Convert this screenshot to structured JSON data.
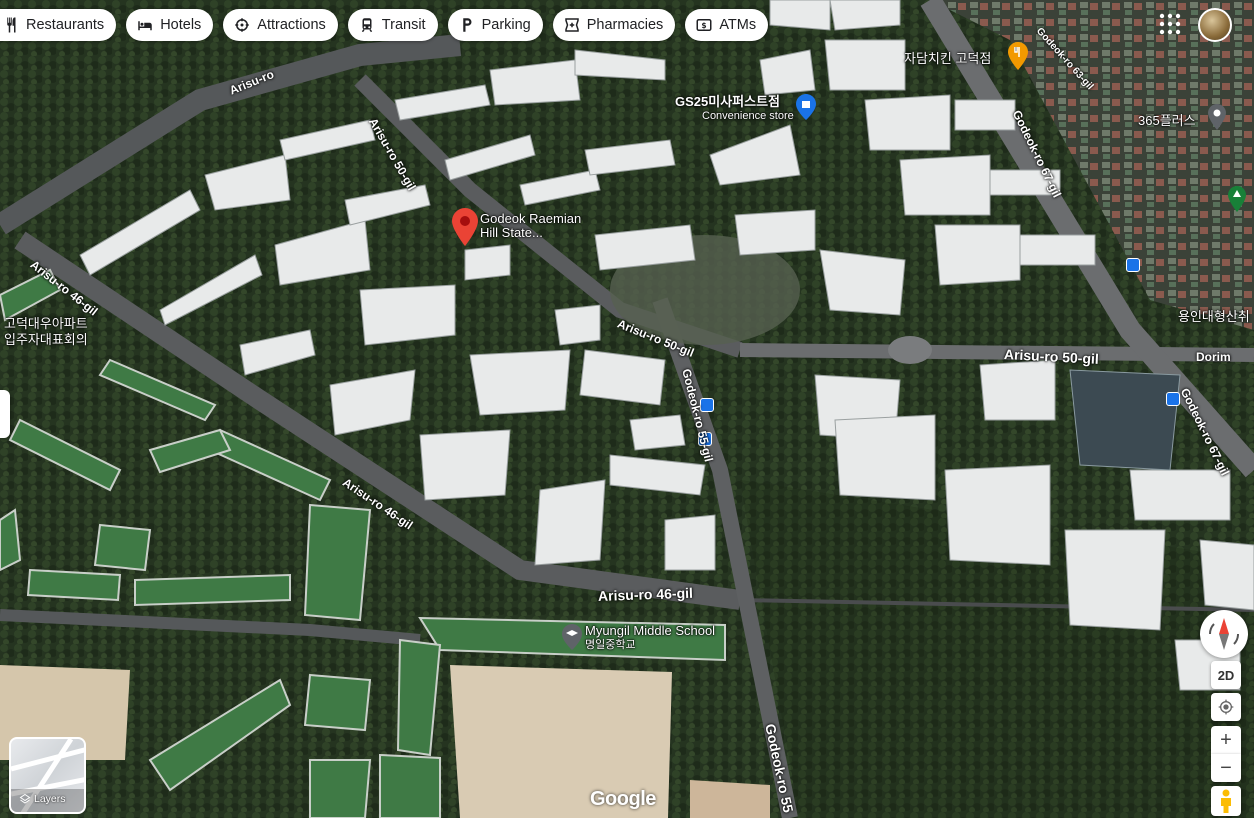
{
  "chips": [
    {
      "label": "Restaurants",
      "icon": "fork-knife-icon"
    },
    {
      "label": "Hotels",
      "icon": "bed-icon"
    },
    {
      "label": "Attractions",
      "icon": "attraction-icon"
    },
    {
      "label": "Transit",
      "icon": "transit-icon"
    },
    {
      "label": "Parking",
      "icon": "parking-icon"
    },
    {
      "label": "Pharmacies",
      "icon": "pharmacy-icon"
    },
    {
      "label": "ATMs",
      "icon": "atm-icon"
    }
  ],
  "places": {
    "selected": {
      "line1": "Godeok Raemian",
      "line2": "Hill State..."
    },
    "gs25": {
      "name": "GS25미사퍼스트점",
      "type": "Convenience store"
    },
    "chicken": {
      "name": "자담치킨 고덕점"
    },
    "plus365": {
      "name": "365플러스"
    },
    "school": {
      "name": "Myungil Middle School",
      "sub": "명일중학교"
    },
    "apt_left": {
      "line1": "고덕대우아파트",
      "line2": "입주자대표회의"
    },
    "right_edge": {
      "name": "용인대형산취"
    }
  },
  "roads": {
    "arisu_ro": "Arisu-ro",
    "arisu_50gil_top": "Arisu-ro 50-gil",
    "arisu_50gil_mid": "Arisu-ro 50-gil",
    "arisu_50gil_right": "Arisu-ro 50-gil",
    "arisu_46gil_left": "Arisu-ro 46-gil",
    "arisu_46gil_diag": "Arisu-ro 46-gil",
    "arisu_46gil_bottom": "Arisu-ro 46-gil",
    "godeok_55gil": "Godeok-ro 55-gil",
    "godeok_55_bottom": "Godeok-ro 55",
    "godeok_67gil": "Godeok-ro 67-gil",
    "godeok_67gil_right": "Godeok-ro 67-gil",
    "dorim": "Dorim",
    "top_right_road": "Godeok-ro 63-gil"
  },
  "controls": {
    "layers_label": "Layers",
    "btn_2d": "2D",
    "zoom_in": "+",
    "zoom_out": "−",
    "google": "Google"
  },
  "colors": {
    "accent": "#1a73e8",
    "pin_red": "#ea4335",
    "pin_orange": "#f29900",
    "pin_grey": "#5f6368",
    "pin_green": "#188038"
  }
}
